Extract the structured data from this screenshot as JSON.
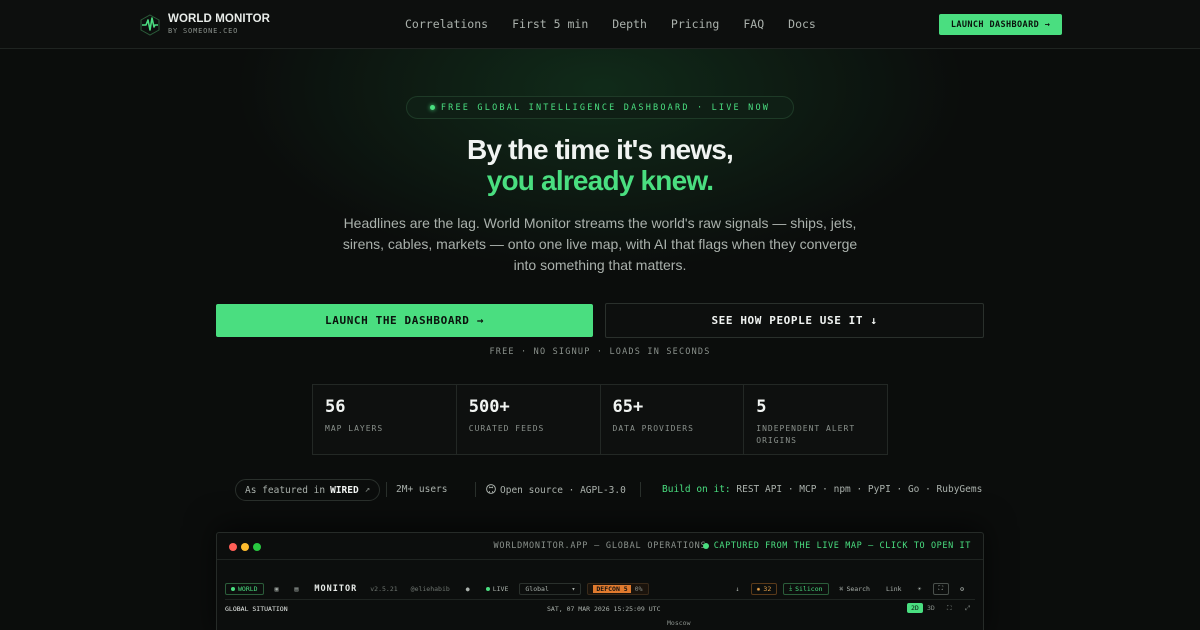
{
  "nav": {
    "brand_title": "WORLD MONITOR",
    "brand_sub": "BY SOMEONE.CEO",
    "links": [
      "Correlations",
      "First 5 min",
      "Depth",
      "Pricing",
      "FAQ",
      "Docs"
    ],
    "cta": "LAUNCH DASHBOARD →"
  },
  "hero": {
    "pill": "FREE GLOBAL INTELLIGENCE DASHBOARD · LIVE NOW",
    "title_line1": "By the time it's news,",
    "title_line2": "you already knew.",
    "lede": "Headlines are the lag. World Monitor streams the world's raw signals — ships, jets, sirens, cables, markets — onto one live map, with AI that flags when they converge into something that matters.",
    "primary_cta": "LAUNCH THE DASHBOARD →",
    "secondary_cta": "SEE HOW PEOPLE USE IT ↓",
    "fine_print": "FREE · NO SIGNUP · LOADS IN SECONDS"
  },
  "stats": [
    {
      "value": "56",
      "label": "MAP LAYERS"
    },
    {
      "value": "500+",
      "label": "CURATED FEEDS"
    },
    {
      "value": "65+",
      "label": "DATA PROVIDERS"
    },
    {
      "value": "5",
      "label": "INDEPENDENT ALERT ORIGINS"
    }
  ],
  "proof": {
    "featured_prefix": "As featured in",
    "featured_name": "WIRED",
    "users": "2M+ users",
    "open_source": "Open source · AGPL-3.0",
    "build_label": "Build on it:",
    "build_items": "REST API · MCP · npm · PyPI · Go · RubyGems"
  },
  "preview": {
    "window_title": "WORLDMONITOR.APP — GLOBAL OPERATIONS",
    "capture_note": "CAPTURED FROM THE LIVE MAP — CLICK TO OPEN IT",
    "app_chip_world": "WORLD",
    "app_name": "MONITOR",
    "app_version": "v2.5.21",
    "app_handle": "@eliehabib",
    "live_label": "LIVE",
    "region_select": "Global",
    "defcon": "DEFCON 5",
    "defcon_pct": "0%",
    "alert_count": "32",
    "silicon": "Silicon",
    "search": "Search",
    "link": "Link",
    "section_title": "GLOBAL SITUATION",
    "timestamp": "SAT, 07 MAR 2026 15:25:09 UTC",
    "view_2d": "2D",
    "view_3d": "3D",
    "map_label": "Moscow"
  },
  "colors": {
    "accent": "#4ade80",
    "background": "#0b0d0c",
    "traffic_red": "#ff5f57",
    "traffic_yellow": "#febc2e",
    "traffic_green": "#28c840"
  }
}
